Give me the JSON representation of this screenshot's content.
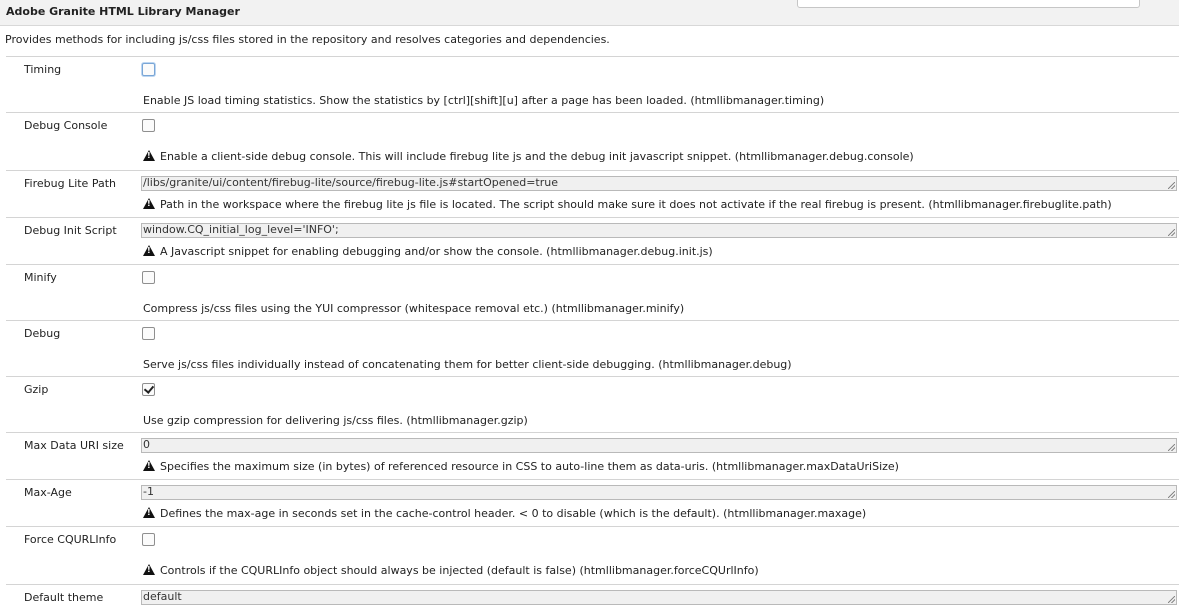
{
  "header": {
    "title": "Adobe Granite HTML Library Manager"
  },
  "description": "Provides methods for including js/css files stored in the repository and resolves categories and dependencies.",
  "fields": [
    {
      "label": "Timing",
      "type": "checkbox",
      "checked": false,
      "focused": true,
      "warning": false,
      "hint": "Enable JS load timing statistics. Show the statistics by [ctrl][shift][u] after a page has been loaded. (htmllibmanager.timing)"
    },
    {
      "label": "Debug Console",
      "type": "checkbox",
      "checked": false,
      "warning": true,
      "hint": "Enable a client-side debug console. This will include firebug lite js and the debug init javascript snippet. (htmllibmanager.debug.console)"
    },
    {
      "label": "Firebug Lite Path",
      "type": "text",
      "value": "/libs/granite/ui/content/firebug-lite/source/firebug-lite.js#startOpened=true",
      "warning": true,
      "hint": "Path in the workspace where the firebug lite js file is located. The script should make sure it does not activate if the real firebug is present. (htmllibmanager.firebuglite.path)"
    },
    {
      "label": "Debug Init Script",
      "type": "text",
      "value": "window.CQ_initial_log_level='INFO';",
      "warning": true,
      "hint": "A Javascript snippet for enabling debugging and/or show the console. (htmllibmanager.debug.init.js)"
    },
    {
      "label": "Minify",
      "type": "checkbox",
      "checked": false,
      "warning": false,
      "hint": "Compress js/css files using the YUI compressor (whitespace removal etc.) (htmllibmanager.minify)"
    },
    {
      "label": "Debug",
      "type": "checkbox",
      "checked": false,
      "warning": false,
      "hint": "Serve js/css files individually instead of concatenating them for better client-side debugging. (htmllibmanager.debug)"
    },
    {
      "label": "Gzip",
      "type": "checkbox",
      "checked": true,
      "warning": false,
      "hint": "Use gzip compression for delivering js/css files. (htmllibmanager.gzip)"
    },
    {
      "label": "Max Data URI size",
      "type": "text",
      "value": "0",
      "warning": true,
      "hint": "Specifies the maximum size (in bytes) of referenced resource in CSS to auto-line them as data-uris. (htmllibmanager.maxDataUriSize)"
    },
    {
      "label": "Max-Age",
      "type": "text",
      "value": "-1",
      "warning": true,
      "hint": "Defines the max-age in seconds set in the cache-control header. < 0 to disable (which is the default). (htmllibmanager.maxage)"
    },
    {
      "label": "Force CQURLInfo",
      "type": "checkbox",
      "checked": false,
      "warning": true,
      "hint": "Controls if the CQURLInfo object should always be injected (default is false) (htmllibmanager.forceCQUrlInfo)"
    },
    {
      "label": "Default theme",
      "type": "text",
      "value": "default",
      "warning": false,
      "hint": ""
    }
  ]
}
